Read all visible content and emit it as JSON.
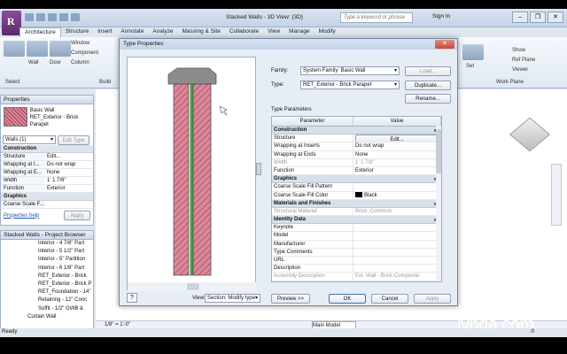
{
  "window": {
    "title": "Stacked Walls - 3D View: {3D}",
    "search_placeholder": "Type a keyword or phrase",
    "signin": "Sign In",
    "controls": [
      "–",
      "❐",
      "✕"
    ],
    "app_letter": "R"
  },
  "ribbon": {
    "tabs": [
      "Architecture",
      "Structure",
      "Insert",
      "Annotate",
      "Analyze",
      "Massing & Site",
      "Collaborate",
      "View",
      "Manage",
      "Modify"
    ],
    "items": [
      "Window",
      "Component",
      "Column",
      "Wall",
      "Door",
      "Show",
      "Ref Plane",
      "Viewer",
      "Set"
    ],
    "groups": [
      "Select",
      "Build",
      "Work Plane"
    ]
  },
  "properties": {
    "title": "Properties",
    "type_family": "Basic Wall",
    "type_name": "RET_Exterior - Brick Parapet",
    "instance_selector": "Walls (1)",
    "edit_type": "Edit Type",
    "sections": {
      "construction": "Construction",
      "graphics": "Graphics"
    },
    "rows": [
      {
        "k": "Structure",
        "v": "Edit..."
      },
      {
        "k": "Wrapping at I...",
        "v": "Do not wrap"
      },
      {
        "k": "Wrapping at E...",
        "v": "None"
      },
      {
        "k": "Width",
        "v": "1' 1 7/8\""
      },
      {
        "k": "Function",
        "v": "Exterior"
      }
    ],
    "gfx_row": "Coarse Scale F...",
    "help": "Properties help",
    "apply": "Apply"
  },
  "browser": {
    "title": "Stacked Walls - Project Browser",
    "items": [
      "Interior - 4 7/8\" Part",
      "Interior - 5 1/2\" Part",
      "Interior - 5\" Partition",
      "Interior - 6 1/8\" Part",
      "RET_Exterior - Brick",
      "RET_Exterior - Brick P",
      "RET_Foundation - 14\"",
      "Retaining - 12\" Conc",
      "Soffit - 1/2\" GWB &",
      "Curtain Wall"
    ]
  },
  "dialog": {
    "title": "Type Properties",
    "family_label": "Family:",
    "family_value": "System Family: Basic Wall",
    "load": "Load...",
    "type_label": "Type:",
    "type_value": "RET_Exterior - Brick Parapet",
    "duplicate": "Duplicate...",
    "rename": "Rename...",
    "type_params": "Type Parameters",
    "col_param": "Parameter",
    "col_value": "Value",
    "sections": [
      "Construction",
      "Graphics",
      "Materials and Finishes",
      "Identity Data"
    ],
    "construction": [
      {
        "p": "Structure",
        "v": "Edit..."
      },
      {
        "p": "Wrapping at Inserts",
        "v": "Do not wrap"
      },
      {
        "p": "Wrapping at Ends",
        "v": "None"
      },
      {
        "p": "Width",
        "v": "1' 1 7/8\""
      },
      {
        "p": "Function",
        "v": "Exterior"
      }
    ],
    "graphics": [
      {
        "p": "Coarse Scale Fill Pattern",
        "v": ""
      },
      {
        "p": "Coarse Scale Fill Color",
        "v": "Black"
      }
    ],
    "materials": [
      {
        "p": "Structural Material",
        "v": "Brick, Common"
      }
    ],
    "identity": [
      {
        "p": "Keynote",
        "v": ""
      },
      {
        "p": "Model",
        "v": ""
      },
      {
        "p": "Manufacturer",
        "v": ""
      },
      {
        "p": "Type Comments",
        "v": ""
      },
      {
        "p": "URL",
        "v": ""
      },
      {
        "p": "Description",
        "v": ""
      },
      {
        "p": "Assembly Description",
        "v": "Ext. Wall - Brick Composite"
      }
    ],
    "view_label": "View:",
    "view_value": "Section: Modify type",
    "preview": "Preview >>",
    "ok": "OK",
    "cancel": "Cancel",
    "apply": "Apply"
  },
  "viewbar": {
    "scale": "1/8\" = 1'-0\"",
    "model": "Main Model"
  },
  "status": {
    "text": "Ready",
    "zero": ":0"
  },
  "watermark": "lynda.com",
  "colors": {
    "brick": "#d9889a",
    "hatch": "#a33a4e",
    "accent_green": "#49a84b",
    "app_purple": "#6b3a80"
  }
}
